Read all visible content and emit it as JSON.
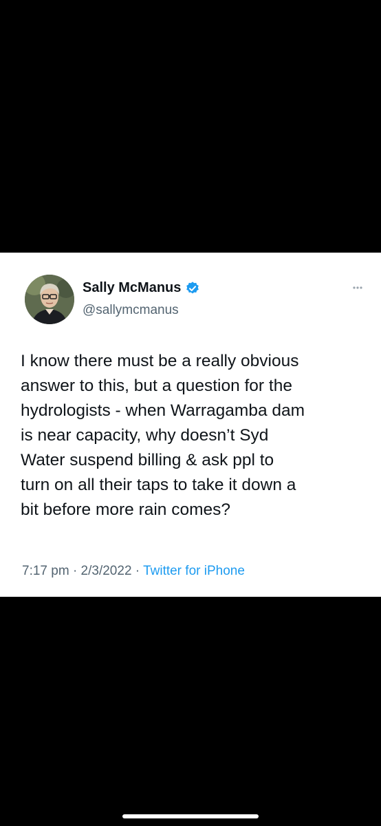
{
  "tweet": {
    "author_name": "Sally McManus",
    "author_handle": "@sallymcmanus",
    "verified": true,
    "text_lines": [
      "I know there must be a really obvious",
      "answer to this, but a question for the",
      "hydrologists - when Warragamba dam",
      "is near capacity, why doesn’t Syd",
      "Water suspend billing & ask ppl to",
      "turn on all their taps to take it down a",
      "bit before more rain comes?"
    ],
    "time": "7:17 pm",
    "date": "2/3/2022",
    "separator": "·",
    "source": "Twitter for iPhone"
  },
  "icons": {
    "verified": "verified-badge-icon",
    "more": "more-dots-icon"
  },
  "colors": {
    "background": "#000000",
    "card": "#ffffff",
    "text_primary": "#0f1419",
    "text_secondary": "#536471",
    "accent": "#1d9bf0"
  }
}
